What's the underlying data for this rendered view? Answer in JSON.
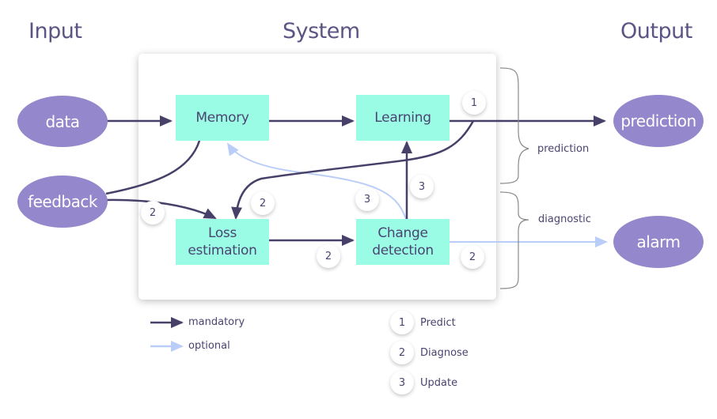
{
  "headers": {
    "input": "Input",
    "system": "System",
    "output": "Output"
  },
  "inputs": [
    {
      "id": "data",
      "label": "data"
    },
    {
      "id": "feedback",
      "label": "feedback"
    }
  ],
  "outputs": [
    {
      "id": "prediction",
      "label": "prediction"
    },
    {
      "id": "alarm",
      "label": "alarm"
    }
  ],
  "components": [
    {
      "id": "memory",
      "label": "Memory"
    },
    {
      "id": "learning",
      "label": "Learning"
    },
    {
      "id": "loss",
      "label": "Loss\nestimation",
      "line1": "Loss",
      "line2": "estimation"
    },
    {
      "id": "change",
      "label": "Change\ndetection",
      "line1": "Change",
      "line2": "detection"
    }
  ],
  "edges": [
    {
      "from": "data",
      "to": "memory",
      "type": "mandatory"
    },
    {
      "from": "memory",
      "to": "learning",
      "type": "mandatory"
    },
    {
      "from": "learning",
      "to": "prediction",
      "type": "mandatory",
      "step": "1"
    },
    {
      "from": "memory",
      "to": "loss",
      "type": "mandatory",
      "via": "feedback"
    },
    {
      "from": "feedback",
      "to": "loss",
      "type": "mandatory",
      "step": "2"
    },
    {
      "from": "learning",
      "to": "loss",
      "type": "mandatory",
      "step": "2"
    },
    {
      "from": "loss",
      "to": "change",
      "type": "mandatory",
      "step": "2"
    },
    {
      "from": "change",
      "to": "learning",
      "type": "mandatory",
      "step": "3"
    },
    {
      "from": "change",
      "to": "memory",
      "type": "optional",
      "step": "3"
    },
    {
      "from": "change",
      "to": "alarm",
      "type": "optional",
      "step": "2"
    }
  ],
  "badges": {
    "learning_out": "1",
    "feedback_loss": "2",
    "learning_loss": "2",
    "loss_change": "2",
    "change_memory": "3",
    "change_learning": "3",
    "change_alarm": "2"
  },
  "braces": {
    "top": "prediction",
    "bottom": "diagnostic"
  },
  "legend": {
    "mandatory": "mandatory",
    "optional": "optional",
    "steps": [
      {
        "num": "1",
        "label": "Predict"
      },
      {
        "num": "2",
        "label": "Diagnose"
      },
      {
        "num": "3",
        "label": "Update"
      }
    ]
  },
  "colors": {
    "mandatory": "#474069",
    "optional": "#b9cdf8",
    "node": "#9487cc",
    "component": "#9bfce6",
    "text": "#4a4470"
  }
}
